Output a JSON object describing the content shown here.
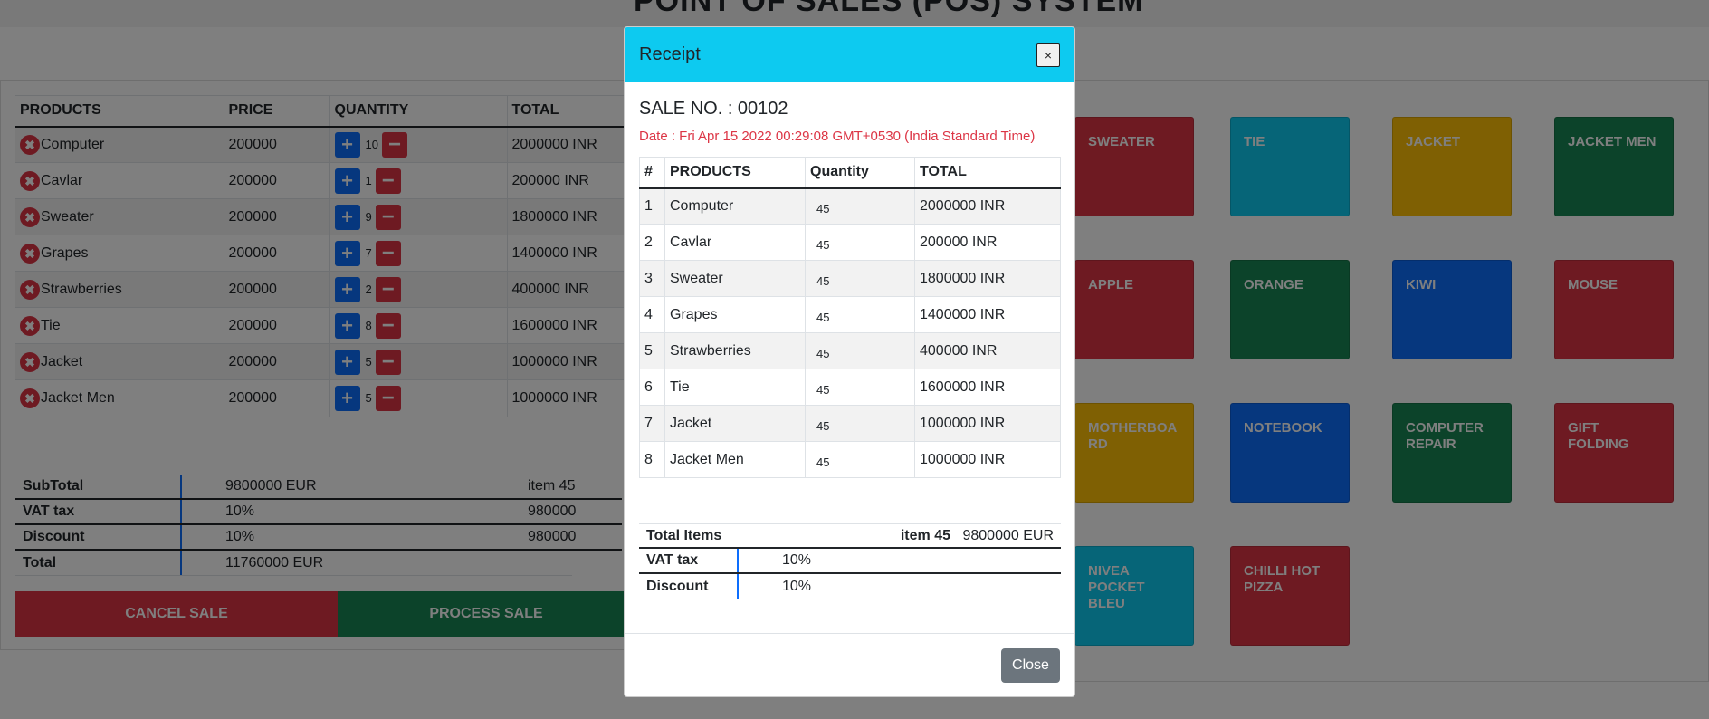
{
  "page": {
    "title": "POINT OF SALES (POS) SYSTEM"
  },
  "cart": {
    "headers": [
      "PRODUCTS",
      "PRICE",
      "QUANTITY",
      "TOTAL"
    ],
    "rows": [
      {
        "name": "Computer",
        "price": "200000",
        "qty": "10",
        "total": "2000000 INR"
      },
      {
        "name": "Cavlar",
        "price": "200000",
        "qty": "1",
        "total": "200000 INR"
      },
      {
        "name": "Sweater",
        "price": "200000",
        "qty": "9",
        "total": "1800000 INR"
      },
      {
        "name": "Grapes",
        "price": "200000",
        "qty": "7",
        "total": "1400000 INR"
      },
      {
        "name": "Strawberries",
        "price": "200000",
        "qty": "2",
        "total": "400000 INR"
      },
      {
        "name": "Tie",
        "price": "200000",
        "qty": "8",
        "total": "1600000 INR"
      },
      {
        "name": "Jacket",
        "price": "200000",
        "qty": "5",
        "total": "1000000 INR"
      },
      {
        "name": "Jacket Men",
        "price": "200000",
        "qty": "5",
        "total": "1000000 INR"
      }
    ],
    "remove_glyph": "✖",
    "plus_glyph": "+",
    "minus_glyph": "−"
  },
  "summary": {
    "subtotal_label": "SubTotal",
    "subtotal_value": "9800000 EUR",
    "items": "item 45",
    "vat_label": "VAT tax",
    "vat_value": "10%",
    "vat_extra": "980000",
    "discount_label": "Discount",
    "discount_value": "10%",
    "discount_extra": "980000",
    "total_label": "Total",
    "total_value": "11760000 EUR"
  },
  "actions": {
    "cancel": "CANCEL SALE",
    "process": "PROCESS SALE"
  },
  "products": [
    "SWEATER",
    "TIE",
    "JACKET",
    "JACKET MEN",
    "APPLE",
    "ORANGE",
    "KIWI",
    "MOUSE",
    "MOTHERBOA RD",
    "NOTEBOOK",
    "COMPUTER REPAIR",
    "GIFT FOLDING",
    "NIVEA POCKET BLEU",
    "CHILLI HOT PIZZA"
  ],
  "colors": {
    "red": "#dc3545",
    "cyan": "#0dcaf0",
    "yellow": "#ffc107",
    "green": "#198754",
    "blue": "#0d6efd",
    "gray": "#6c757d"
  },
  "modal": {
    "title": "Receipt",
    "close_x": "×",
    "sale_no": "SALE NO. : 00102",
    "date": "Date : Fri Apr 15 2022 00:29:08 GMT+0530 (India Standard Time)",
    "headers": [
      "#",
      "PRODUCTS",
      "Quantity",
      "TOTAL"
    ],
    "rows": [
      {
        "n": "1",
        "name": "Computer",
        "qty": "45",
        "total": "2000000 INR"
      },
      {
        "n": "2",
        "name": "Cavlar",
        "qty": "45",
        "total": "200000 INR"
      },
      {
        "n": "3",
        "name": "Sweater",
        "qty": "45",
        "total": "1800000 INR"
      },
      {
        "n": "4",
        "name": "Grapes",
        "qty": "45",
        "total": "1400000 INR"
      },
      {
        "n": "5",
        "name": "Strawberries",
        "qty": "45",
        "total": "400000 INR"
      },
      {
        "n": "6",
        "name": "Tie",
        "qty": "45",
        "total": "1600000 INR"
      },
      {
        "n": "7",
        "name": "Jacket",
        "qty": "45",
        "total": "1000000 INR"
      },
      {
        "n": "8",
        "name": "Jacket Men",
        "qty": "45",
        "total": "1000000 INR"
      }
    ],
    "total_items_label": "Total Items",
    "total_items_count": "item 45",
    "total_items_value": "9800000 EUR",
    "vat_label": "VAT tax",
    "vat_value": "10%",
    "discount_label": "Discount",
    "discount_value": "10%",
    "close_button": "Close"
  }
}
